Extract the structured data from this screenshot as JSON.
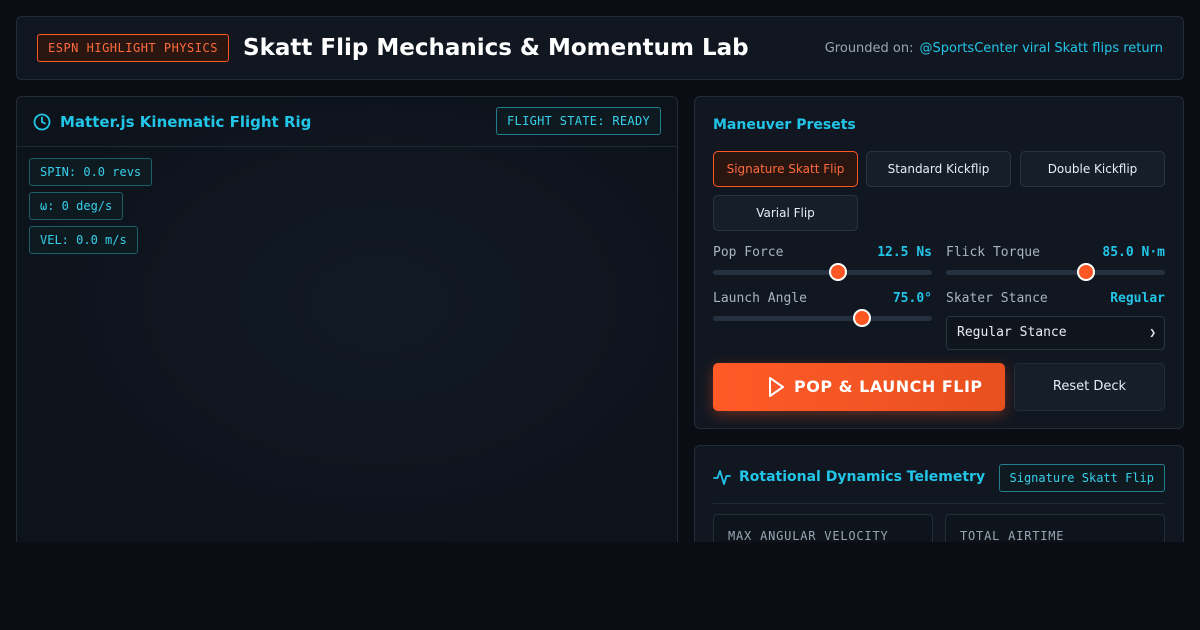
{
  "header": {
    "badge": "ESPN HIGHLIGHT PHYSICS",
    "title": "Skatt Flip Mechanics & Momentum Lab",
    "grounded_label": "Grounded on:",
    "grounded_link": "@SportsCenter viral Skatt flips return"
  },
  "rig": {
    "title": "Matter.js Kinematic Flight Rig",
    "flight_state": "FLIGHT STATE: READY",
    "readouts": {
      "spin": "SPIN: 0.0 revs",
      "omega": "ω: 0 deg/s",
      "vel": "VEL: 0.0 m/s"
    }
  },
  "presets": {
    "title": "Maneuver Presets",
    "buttons": [
      {
        "label": "Signature Skatt Flip",
        "active": true
      },
      {
        "label": "Standard Kickflip",
        "active": false
      },
      {
        "label": "Double Kickflip",
        "active": false
      },
      {
        "label": "Varial Flip",
        "active": false
      }
    ]
  },
  "controls": {
    "pop_force": {
      "label": "Pop Force",
      "value": "12.5 Ns",
      "fraction": 0.57
    },
    "flick_torque": {
      "label": "Flick Torque",
      "value": "85.0 N·m",
      "fraction": 0.64
    },
    "launch_angle": {
      "label": "Launch Angle",
      "value": "75.0°",
      "fraction": 0.68
    },
    "stance": {
      "label": "Skater Stance",
      "value": "Regular",
      "selected": "Regular Stance"
    }
  },
  "actions": {
    "launch": "POP & LAUNCH FLIP",
    "reset": "Reset Deck"
  },
  "telemetry": {
    "title": "Rotational Dynamics Telemetry",
    "badge": "Signature Skatt Flip",
    "stats": [
      {
        "label": "MAX ANGULAR VELOCITY"
      },
      {
        "label": "TOTAL AIRTIME"
      }
    ]
  },
  "colors": {
    "accent": "#ff5722",
    "cyan": "#22c5e8",
    "background": "#0a0e14"
  }
}
